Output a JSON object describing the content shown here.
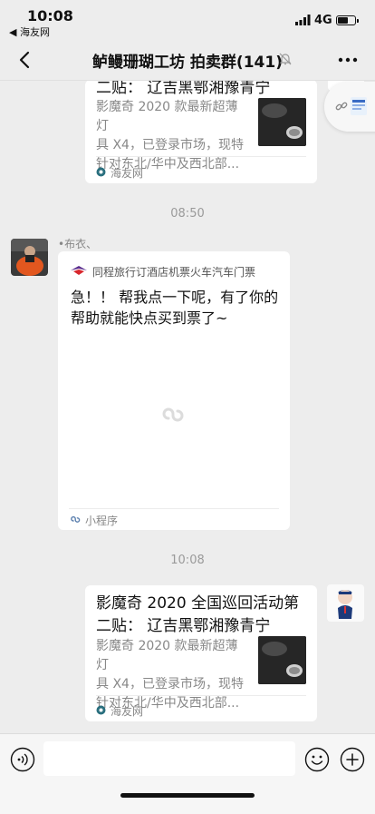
{
  "status_bar": {
    "time": "10:08",
    "back_app": "◀ 海友网",
    "network": "4G"
  },
  "nav": {
    "title": "鲈鳗珊瑚工坊 拍卖群(141)"
  },
  "messages": {
    "card1": {
      "title_line2": "二贴： 辽吉黑鄂湘豫青宁",
      "desc": [
        "影魔奇 2020 款最新超薄灯",
        "具 X4，已登录市场，现特",
        "针对东北/华中及西北部..."
      ],
      "source": "海友网"
    },
    "time1": "08:50",
    "msg2": {
      "sender": "•布衣、",
      "app_name": "同程旅行订酒店机票火车汽车门票",
      "text": [
        "急！！ 帮我点一下呢，有了你的",
        "帮助就能快点买到票了~"
      ],
      "footer": "小程序"
    },
    "time2": "10:08",
    "card3": {
      "title": [
        "影魔奇 2020 全国巡回活动第",
        "二贴： 辽吉黑鄂湘豫青宁"
      ],
      "desc": [
        "影魔奇 2020 款最新超薄灯",
        "具 X4，已登录市场，现特",
        "针对东北/华中及西北部..."
      ],
      "source": "海友网"
    }
  },
  "input": {
    "value": ""
  },
  "colors": {
    "background": "#ededed",
    "card": "#ffffff",
    "muted_text": "#888888"
  }
}
